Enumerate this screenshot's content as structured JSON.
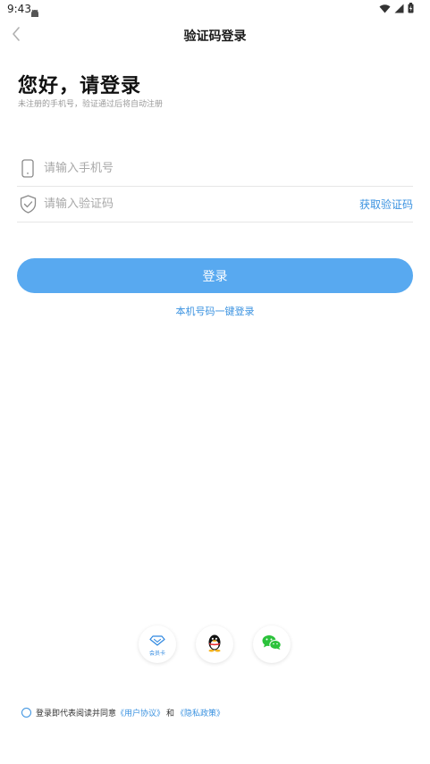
{
  "status_bar": {
    "time": "9:43"
  },
  "header": {
    "title": "验证码登录"
  },
  "greeting": {
    "title": "您好，请登录",
    "subtitle": "未注册的手机号，验证通过后将自动注册"
  },
  "form": {
    "phone_placeholder": "请输入手机号",
    "code_placeholder": "请输入验证码",
    "get_code_label": "获取验证码"
  },
  "actions": {
    "login_label": "登录",
    "one_click_login_label": "本机号码一键登录"
  },
  "third_party": {
    "member_card_label": "会员卡"
  },
  "agreement": {
    "prefix": "登录即代表阅读并同意",
    "user_agreement": "《用户协议》",
    "conjunction": "和",
    "privacy_policy": "《隐私政策》"
  },
  "colors": {
    "accent": "#58a9f0",
    "link": "#3a92e0",
    "wechat_green": "#2bc23b"
  },
  "icons": {
    "status_app": "android-icon",
    "wifi": "wifi-icon",
    "signal": "signal-icon",
    "battery": "battery-icon",
    "back": "chevron-left-icon",
    "phone": "phone-icon",
    "code": "shield-check-icon",
    "member": "diamond-icon",
    "qq": "qq-penguin-icon",
    "wechat": "wechat-icon"
  }
}
